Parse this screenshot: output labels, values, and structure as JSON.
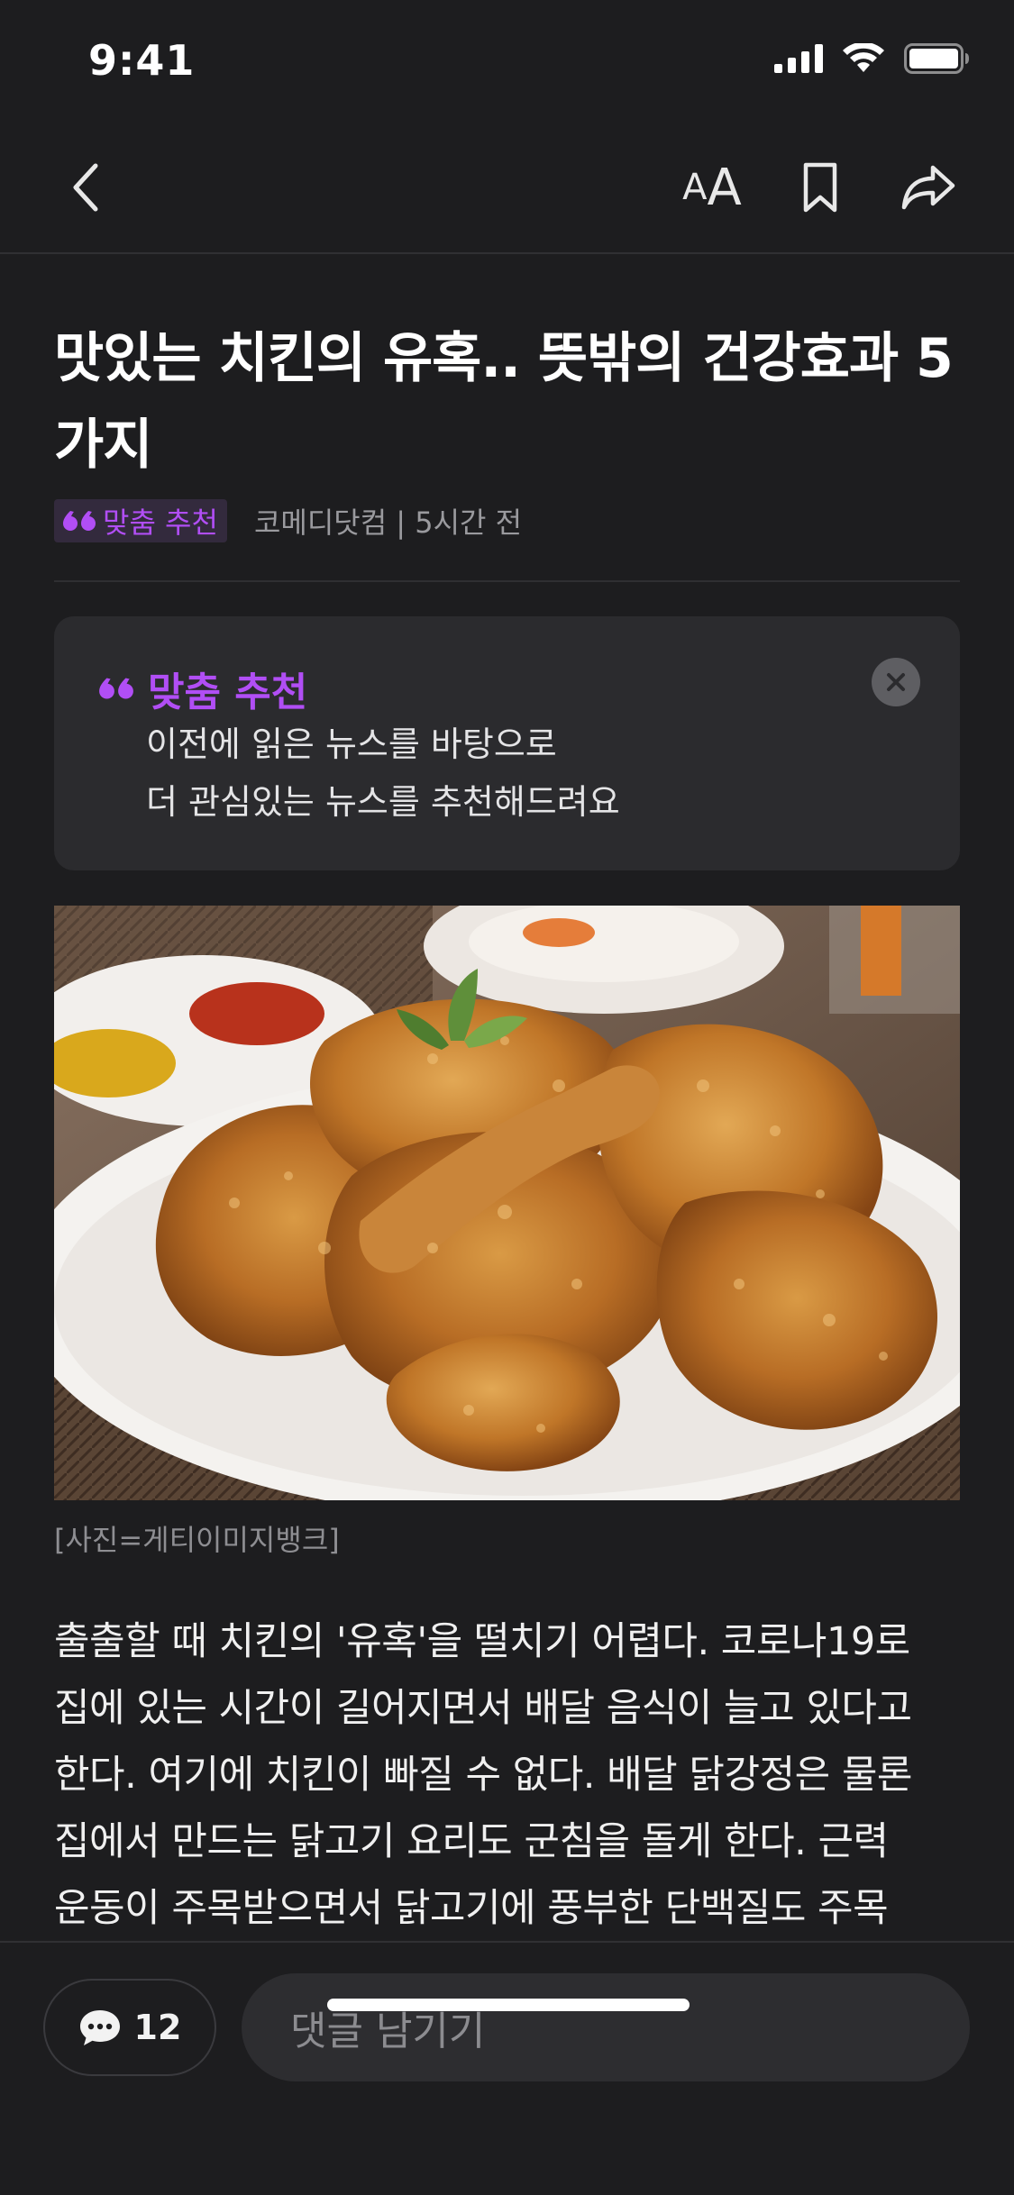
{
  "status_bar": {
    "time": "9:41"
  },
  "nav": {
    "text_size_small": "A",
    "text_size_large": "A"
  },
  "article": {
    "title_lines": [
      "맛있는 치킨의 유혹.. 뜻밖의 건강효과 5",
      "가지"
    ],
    "tag_label": "맞춤 추천",
    "source_time": "코메디닷컴 | 5시간 전",
    "image_caption": "[사진=게티이미지뱅크]",
    "body_lines": [
      "출출할 때 치킨의 '유혹'을 떨치기 어렵다. 코로나19로",
      "집에 있는 시간이 길어지면서 배달 음식이 늘고 있다고",
      "한다. 여기에 치킨이 빠질 수 없다. 배달 닭강정은 물론",
      "집에서 만드는 닭고기 요리도 군침을 돌게 한다. 근력",
      "운동이 주목받으면서 닭고기에 풍부한 단백질도 주목"
    ]
  },
  "recommendation": {
    "title": "맞춤 추천",
    "desc_lines": [
      "이전에 읽은 뉴스를 바탕으로",
      "더 관심있는 뉴스를 추천해드려요"
    ]
  },
  "bottom_bar": {
    "comment_count": "12",
    "comment_placeholder": "댓글 남기기"
  },
  "colors": {
    "accent": "#b14ef5",
    "background": "#1d1d1f",
    "card": "#2b2b2e"
  }
}
